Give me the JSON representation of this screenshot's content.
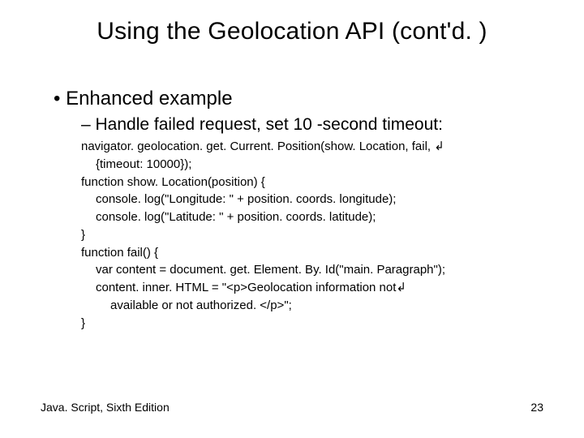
{
  "title": "Using the Geolocation API (cont'd. )",
  "bullets": {
    "b1": "Enhanced example",
    "b2": "Handle failed request, set 10 -second timeout:"
  },
  "code": {
    "l01": "navigator. geolocation. get. Current. Position(show. Location, fail, ↲",
    "l02": "{timeout: 10000});",
    "l03": "function show. Location(position) {",
    "l04": "console. log(\"Longitude: \" + position. coords. longitude);",
    "l05": "console. log(\"Latitude: \" + position. coords. latitude);",
    "l06": "}",
    "l07": "function fail() {",
    "l08": "var content = document. get. Element. By. Id(\"main. Paragraph\");",
    "l09": "content. inner. HTML = \"<p>Geolocation information not↲",
    "l10": "available or not authorized. </p>\";",
    "l11": "}"
  },
  "footer": {
    "left": "Java. Script, Sixth Edition",
    "right": "23"
  }
}
